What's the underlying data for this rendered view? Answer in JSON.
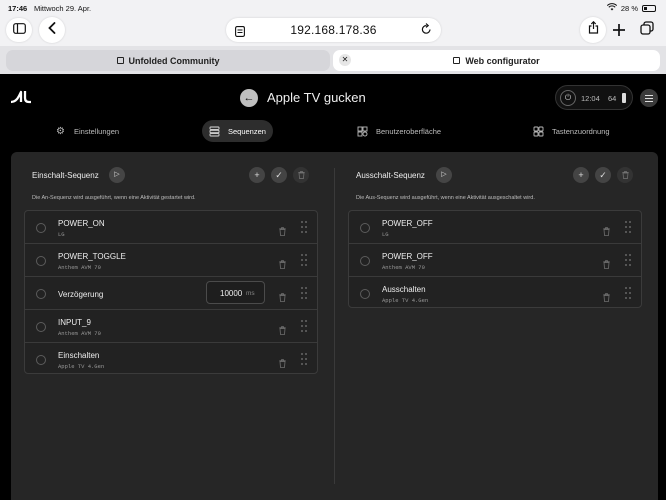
{
  "status_bar": {
    "time": "17:46",
    "date": "Mittwoch 29. Apr.",
    "battery": "28 %"
  },
  "browser": {
    "url": "192.168.178.36",
    "tabs": [
      {
        "label": "Unfolded Community",
        "active": false
      },
      {
        "label": "Web configurator",
        "active": true
      }
    ]
  },
  "app": {
    "title": "Apple TV gucken",
    "status": {
      "clock": "12:04",
      "battery": "64"
    },
    "nav": [
      {
        "label": "Einstellungen",
        "icon": "gear-icon"
      },
      {
        "label": "Sequenzen",
        "icon": "sequence-icon",
        "active": true
      },
      {
        "label": "Benutzeroberfläche",
        "icon": "ui-grid-icon"
      },
      {
        "label": "Tastenzuordnung",
        "icon": "keymap-icon"
      }
    ]
  },
  "on_sequence": {
    "title": "Einschalt-Sequenz",
    "description": "Die An-Sequenz wird ausgeführt, wenn eine Aktivität gestartet wird.",
    "items": [
      {
        "name": "POWER_ON",
        "device": "LG"
      },
      {
        "name": "POWER_TOGGLE",
        "device": "Anthem AVM 70"
      },
      {
        "name": "Verzögerung",
        "delay_value": "10000",
        "delay_unit": "ms"
      },
      {
        "name": "INPUT_9",
        "device": "Anthem AVM 70"
      },
      {
        "name": "Einschalten",
        "device": "Apple TV 4.Gen"
      }
    ]
  },
  "off_sequence": {
    "title": "Ausschalt-Sequenz",
    "description": "Die Aus-Sequenz wird ausgeführt, wenn eine Aktivität ausgeschaltet wird.",
    "items": [
      {
        "name": "POWER_OFF",
        "device": "LG"
      },
      {
        "name": "POWER_OFF",
        "device": "Anthem AVM 70"
      },
      {
        "name": "Ausschalten",
        "device": "Apple TV 4.Gen"
      }
    ]
  }
}
